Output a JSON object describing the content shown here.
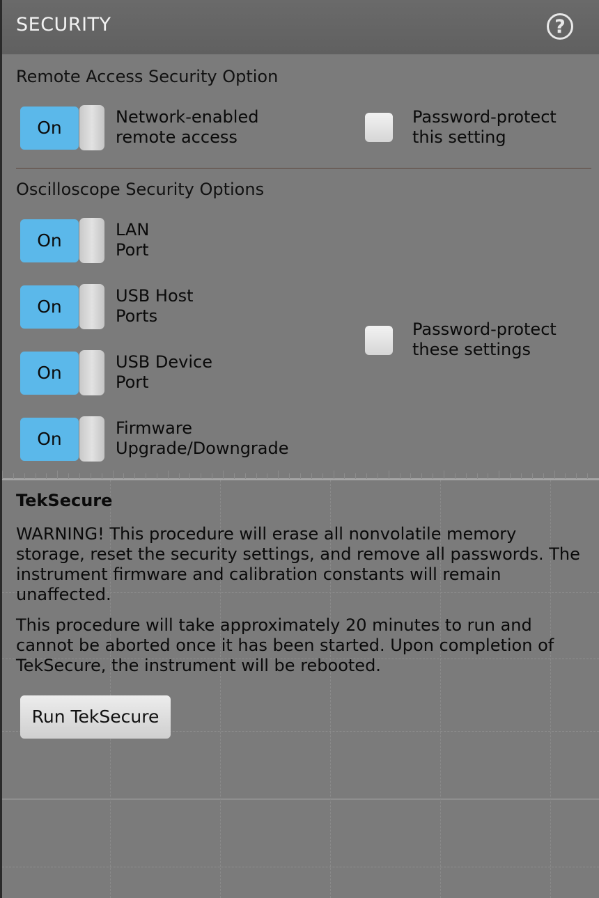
{
  "header": {
    "title": "SECURITY",
    "help_icon": "?"
  },
  "remote": {
    "section_title": "Remote Access Security Option",
    "toggle": {
      "state": "On",
      "label_line1": "Network-enabled",
      "label_line2": "remote access"
    },
    "password": {
      "label_line1": "Password-protect",
      "label_line2": "this setting",
      "checked": false
    }
  },
  "scope": {
    "section_title": "Oscilloscope Security Options",
    "toggles": [
      {
        "state": "On",
        "label_line1": "LAN",
        "label_line2": "Port"
      },
      {
        "state": "On",
        "label_line1": "USB Host",
        "label_line2": "Ports"
      },
      {
        "state": "On",
        "label_line1": "USB Device",
        "label_line2": "Port"
      },
      {
        "state": "On",
        "label_line1": "Firmware",
        "label_line2": "Upgrade/Downgrade"
      }
    ],
    "password": {
      "label_line1": "Password-protect",
      "label_line2": "these settings",
      "checked": false
    }
  },
  "teksecure": {
    "title": "TekSecure",
    "warning": "WARNING! This procedure will erase all nonvolatile memory storage, reset the security settings, and remove all passwords. The instrument firmware and calibration constants will remain unaffected.",
    "info": "This procedure will take approximately 20 minutes to run and cannot be aborted once it has been started. Upon completion of TekSecure, the instrument will be rebooted.",
    "button_label": "Run TekSecure"
  },
  "colors": {
    "toggle_on": "#5bb8ea",
    "panel": "#7b7b7b",
    "header": "#666666"
  }
}
